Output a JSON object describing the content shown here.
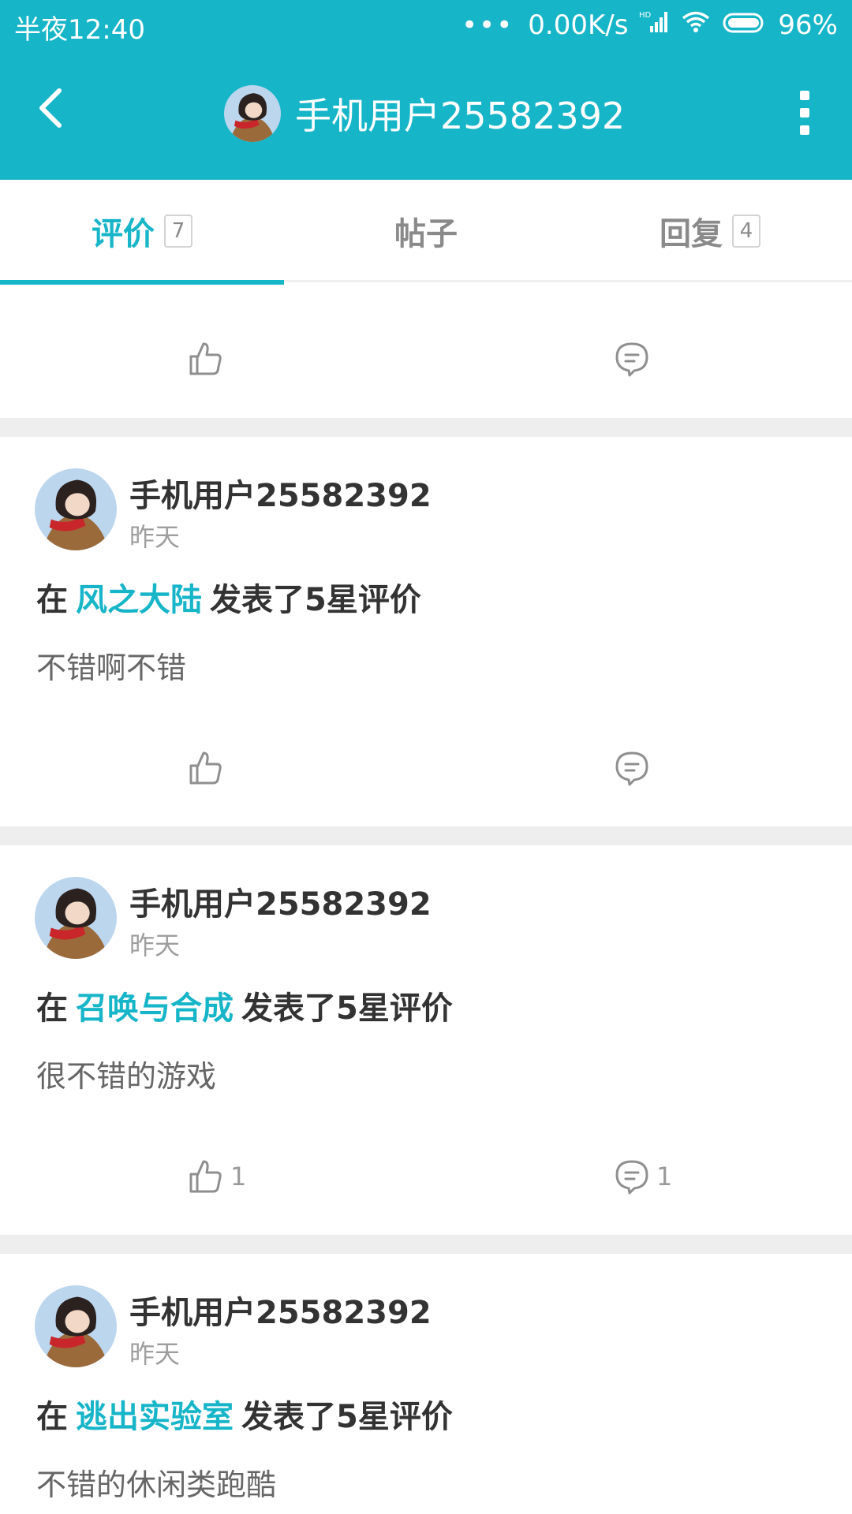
{
  "status_bar": {
    "time": "半夜12:40",
    "network_speed": "0.00K/s",
    "network_type": "HD",
    "battery": "96%"
  },
  "app_bar": {
    "title": "手机用户25582392"
  },
  "tabs": [
    {
      "label": "评价",
      "count": "7",
      "active": true
    },
    {
      "label": "帖子",
      "count": "",
      "active": false
    },
    {
      "label": "回复",
      "count": "4",
      "active": false
    }
  ],
  "cards": [
    {
      "username": "手机用户25582392",
      "time": "昨天",
      "prefix": "在",
      "game": "风之大陆",
      "suffix": "发表了5星评价",
      "review": "不错啊不错",
      "likes": "",
      "comments": ""
    },
    {
      "username": "手机用户25582392",
      "time": "昨天",
      "prefix": "在",
      "game": "召唤与合成",
      "suffix": "发表了5星评价",
      "review": "很不错的游戏",
      "likes": "1",
      "comments": "1"
    },
    {
      "username": "手机用户25582392",
      "time": "昨天",
      "prefix": "在",
      "game": "逃出实验室",
      "suffix": "发表了5星评价",
      "review": "不错的休闲类跑酷",
      "likes": "",
      "comments": ""
    }
  ],
  "colors": {
    "accent": "#17b5c8",
    "divider": "#eeeeee"
  }
}
